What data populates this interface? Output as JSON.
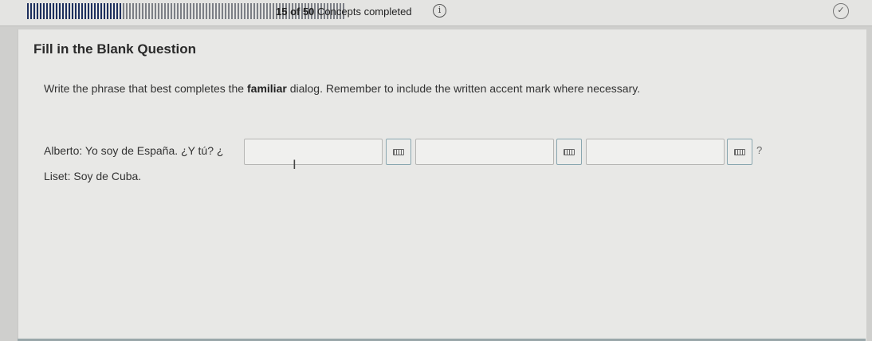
{
  "progress": {
    "completed": 15,
    "total": 50,
    "label": "15 of 50 Concepts completed",
    "count_text": "15 of 50",
    "suffix_text": "Concepts completed"
  },
  "icons": {
    "info": "info-icon",
    "check": "check-circle-icon",
    "keyboard": "keyboard-icon",
    "text_cursor": "text-cursor-icon"
  },
  "question": {
    "title": "Fill in the Blank Question",
    "instruction_before": "Write the phrase that best completes the ",
    "instruction_bold": "familiar",
    "instruction_after": " dialog. Remember to include the written accent mark where necessary.",
    "line1_prefix": "Alberto: Yo soy de España. ¿Y tú? ¿",
    "line1_suffix": "?",
    "line2": "Liset: Soy de Cuba.",
    "blanks": [
      {
        "value": ""
      },
      {
        "value": ""
      },
      {
        "value": ""
      }
    ]
  },
  "colors": {
    "progress_done": "#1d2f5e",
    "progress_remaining": "#f2f2f0"
  }
}
